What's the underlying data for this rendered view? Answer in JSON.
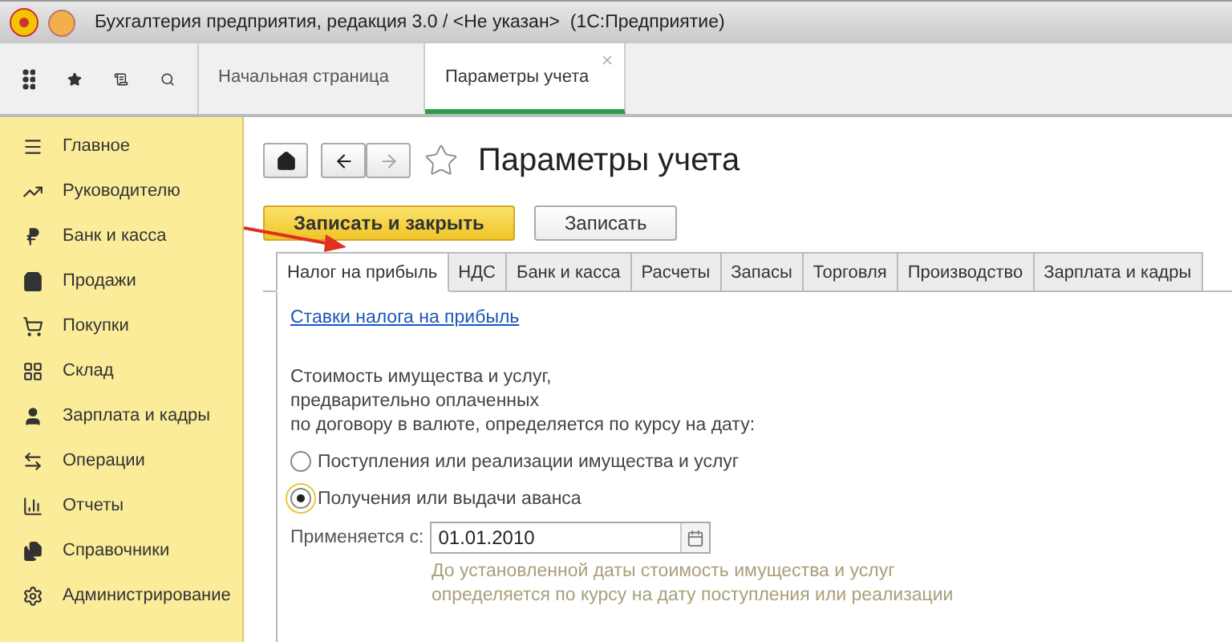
{
  "window": {
    "title": "Бухгалтерия предприятия, редакция 3.0 / <Не указан>  (1С:Предприятие)"
  },
  "app_tabs": [
    {
      "label": "Начальная страница",
      "selected": false,
      "closable": false
    },
    {
      "label": "Параметры учета",
      "selected": true,
      "closable": true
    }
  ],
  "sidebar": {
    "items": [
      {
        "label": "Главное"
      },
      {
        "label": "Руководителю"
      },
      {
        "label": "Банк и касса"
      },
      {
        "label": "Продажи"
      },
      {
        "label": "Покупки"
      },
      {
        "label": "Склад"
      },
      {
        "label": "Зарплата и кадры"
      },
      {
        "label": "Операции"
      },
      {
        "label": "Отчеты"
      },
      {
        "label": "Справочники"
      },
      {
        "label": "Администрирование"
      }
    ]
  },
  "form": {
    "title": "Параметры учета",
    "favorite": false,
    "back_disabled": false,
    "forward_disabled": true,
    "buttons": [
      {
        "label": "Записать и закрыть",
        "kind": "primary"
      },
      {
        "label": "Записать",
        "kind": "default"
      }
    ],
    "tabs": [
      {
        "label": "Налог на прибыль",
        "selected": true
      },
      {
        "label": "НДС",
        "selected": false
      },
      {
        "label": "Банк и касса",
        "selected": false
      },
      {
        "label": "Расчеты",
        "selected": false
      },
      {
        "label": "Запасы",
        "selected": false
      },
      {
        "label": "Торговля",
        "selected": false
      },
      {
        "label": "Производство",
        "selected": false
      },
      {
        "label": "Зарплата и кадры",
        "selected": false
      }
    ],
    "link": "Ставки налога на прибыль",
    "description_lines": [
      "Стоимость имущества и услуг,",
      "предварительно оплаченных",
      "по договору в валюте, определяется по курсу на дату:"
    ],
    "radios": [
      {
        "label": "Поступления или реализации имущества и услуг",
        "selected": false,
        "focused": false
      },
      {
        "label": "Получения или выдачи аванса",
        "selected": true,
        "focused": true
      }
    ],
    "date_field": {
      "label": "Применяется с:",
      "value": "01.01.2010"
    },
    "note_lines": [
      "До установленной даты стоимость имущества и услуг",
      "определяется по курсу на дату поступления или реализации"
    ]
  },
  "annotation": {
    "kind": "arrow"
  }
}
